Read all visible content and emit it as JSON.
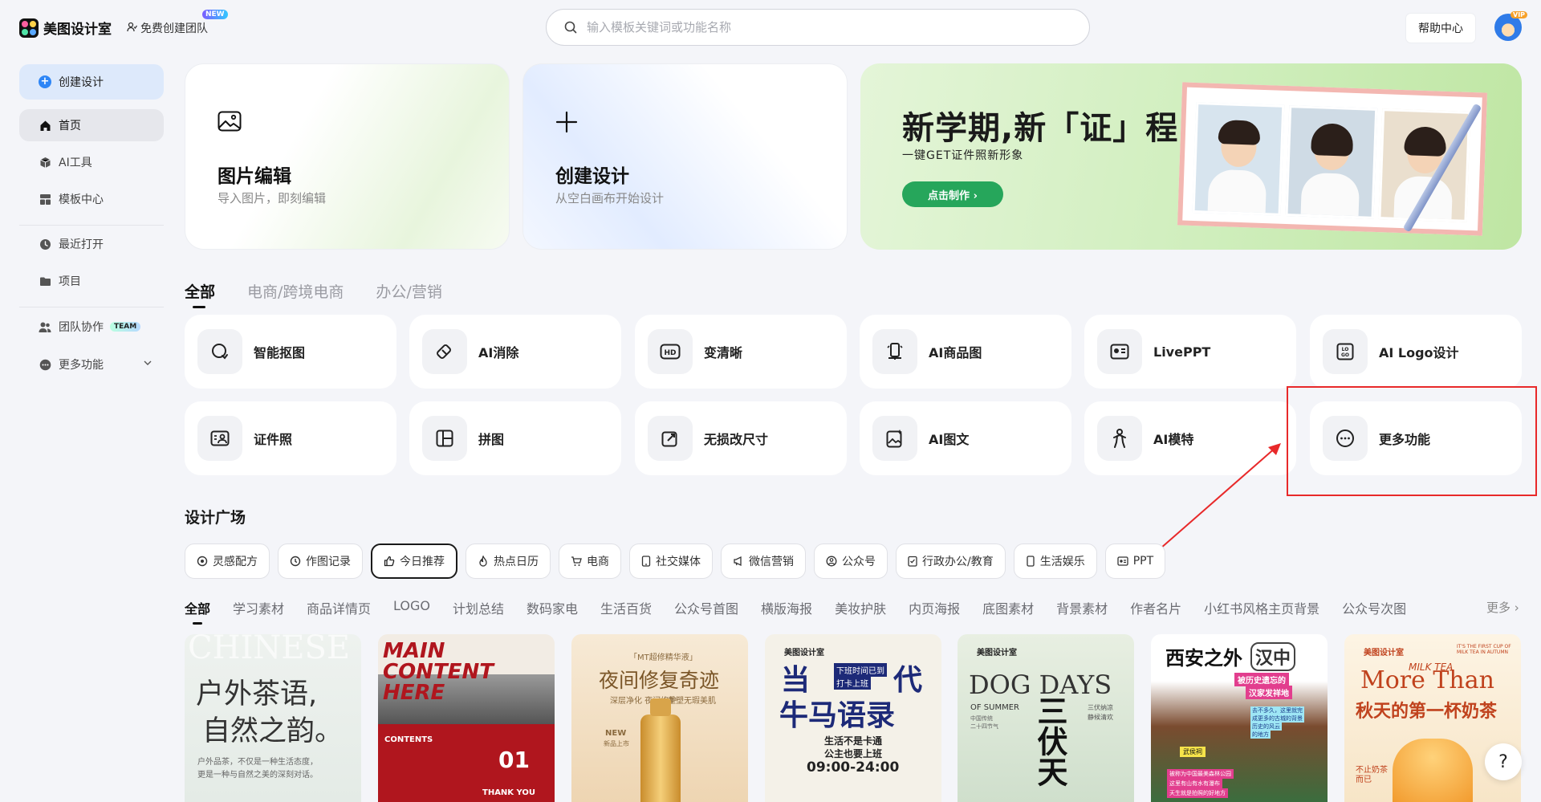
{
  "header": {
    "brand_name": "美图设计室",
    "free_team": "免费创建团队",
    "new_badge": "NEW",
    "search_placeholder": "输入模板关键词或功能名称",
    "help": "帮助中心",
    "vip_badge": "VIP"
  },
  "sidebar": {
    "create": "创建设计",
    "items": [
      {
        "label": "首页",
        "icon": "home-icon"
      },
      {
        "label": "AI工具",
        "icon": "cube-icon"
      },
      {
        "label": "模板中心",
        "icon": "template-icon"
      },
      {
        "label": "最近打开",
        "icon": "clock-icon"
      },
      {
        "label": "项目",
        "icon": "folder-icon"
      },
      {
        "label": "团队协作",
        "icon": "team-icon"
      },
      {
        "label": "更多功能",
        "icon": "more-icon"
      }
    ],
    "team_badge": "TEAM"
  },
  "hero": {
    "edit_title": "图片编辑",
    "edit_sub": "导入图片，即刻编辑",
    "create_title": "创建设计",
    "create_sub": "从空白画布开始设计",
    "banner_title": "新学期,新「证」程",
    "banner_sub": "一键GET证件照新形象",
    "banner_btn": "点击制作 ›"
  },
  "category_tabs": [
    "全部",
    "电商/跨境电商",
    "办公/营销"
  ],
  "tools": [
    {
      "label": "智能抠图",
      "icon": "smart-cutout-icon"
    },
    {
      "label": "AI消除",
      "icon": "ai-eraser-icon"
    },
    {
      "label": "变清晰",
      "icon": "hd-icon"
    },
    {
      "label": "AI商品图",
      "icon": "product-image-icon"
    },
    {
      "label": "LivePPT",
      "icon": "liveppt-icon"
    },
    {
      "label": "AI Logo设计",
      "icon": "logo-design-icon"
    },
    {
      "label": "证件照",
      "icon": "id-photo-icon"
    },
    {
      "label": "拼图",
      "icon": "collage-icon"
    },
    {
      "label": "无损改尺寸",
      "icon": "resize-icon"
    },
    {
      "label": "AI图文",
      "icon": "ai-image-text-icon"
    },
    {
      "label": "AI模特",
      "icon": "ai-model-icon"
    },
    {
      "label": "更多功能",
      "icon": "more-functions-icon"
    }
  ],
  "plaza": {
    "title": "设计广场",
    "chips": [
      "灵感配方",
      "作图记录",
      "今日推荐",
      "热点日历",
      "电商",
      "社交媒体",
      "微信营销",
      "公众号",
      "行政办公/教育",
      "生活娱乐",
      "PPT"
    ],
    "sub_tabs": [
      "全部",
      "学习素材",
      "商品详情页",
      "LOGO",
      "计划总结",
      "数码家电",
      "生活百货",
      "公众号首图",
      "横版海报",
      "美妆护肤",
      "内页海报",
      "底图素材",
      "背景素材",
      "作者名片",
      "小红书风格主页背景",
      "公众号次图"
    ],
    "more": "更多 ›"
  },
  "templates": {
    "t1_title_a": "户外茶语,",
    "t1_title_b": "自然之韵。",
    "t1_bg": "CHINESE",
    "t1_small_a": "户外品茶，不仅是一种生活态度，",
    "t1_small_b": "更是一种与自然之美的深刻对话。",
    "t2_title": "MAIN CONTENT HERE",
    "t2_small_a": "CONTENTS",
    "t2_small_b": "01",
    "t2_small_c": "THANK YOU",
    "t3_tag": "「MT超修精华液」",
    "t3_title": "夜间修复奇迹",
    "t3_sub_a": "深层净化 夜间修护",
    "t3_sub_b": "重塑无瑕美肌",
    "t3_new": "NEW",
    "t3_new_b": "新品上市",
    "t4_brand": "美图设计室",
    "t4_title_a": "当",
    "t4_tag_a": "下班时间已到",
    "t4_tag_b": "打卡上班",
    "t4_title_b": "代",
    "t4_title_c": "牛马语录",
    "t4_sub_a": "生活不是卡通",
    "t4_sub_b": "公主也要上班",
    "t4_time": "09:00-24:00",
    "t5_brand": "美图设计室",
    "t5_title": "DOG DAYS",
    "t5_sub": "OF SUMMER",
    "t5_sub_b": "中国传统",
    "t5_sub_c": "二十四节气",
    "t5_side": "三伏纳凉",
    "t5_side_b": "静候清欢",
    "t5_cn": "三伏天",
    "t6_title_a": "西安之外",
    "t6_title_b": "汉中",
    "t6_tag": "被历史遗忘的",
    "t6_tag_b": "汉家发祥地",
    "t6_note_a": "去不多久，这里就完",
    "t6_note_b": "成更多的古城的背景",
    "t6_note_c": "历史的风云",
    "t6_note_d": "的地方",
    "t6_tag_c": "武侯祠",
    "t6_tag_d": "被称为中国最美森林公园",
    "t6_tag_e": "这里有山有水有瀑布",
    "t6_tag_f": "天生就是拍照的好地方",
    "t7_brand": "美图设计室",
    "t7_en": "More Than",
    "t7_script": "MILK TEA",
    "t7_corner": "IT'S THE FIRST CUP OF MILK TEA IN AUTUMN",
    "t7_title": "秋天的第一杯奶茶",
    "t7_small": "不止奶茶",
    "t7_small_b": "而已"
  },
  "help_float": "?",
  "colors": {
    "accent_blue": "#2f86f6",
    "highlight_red": "#e8292a",
    "banner_green": "#26a65b"
  }
}
